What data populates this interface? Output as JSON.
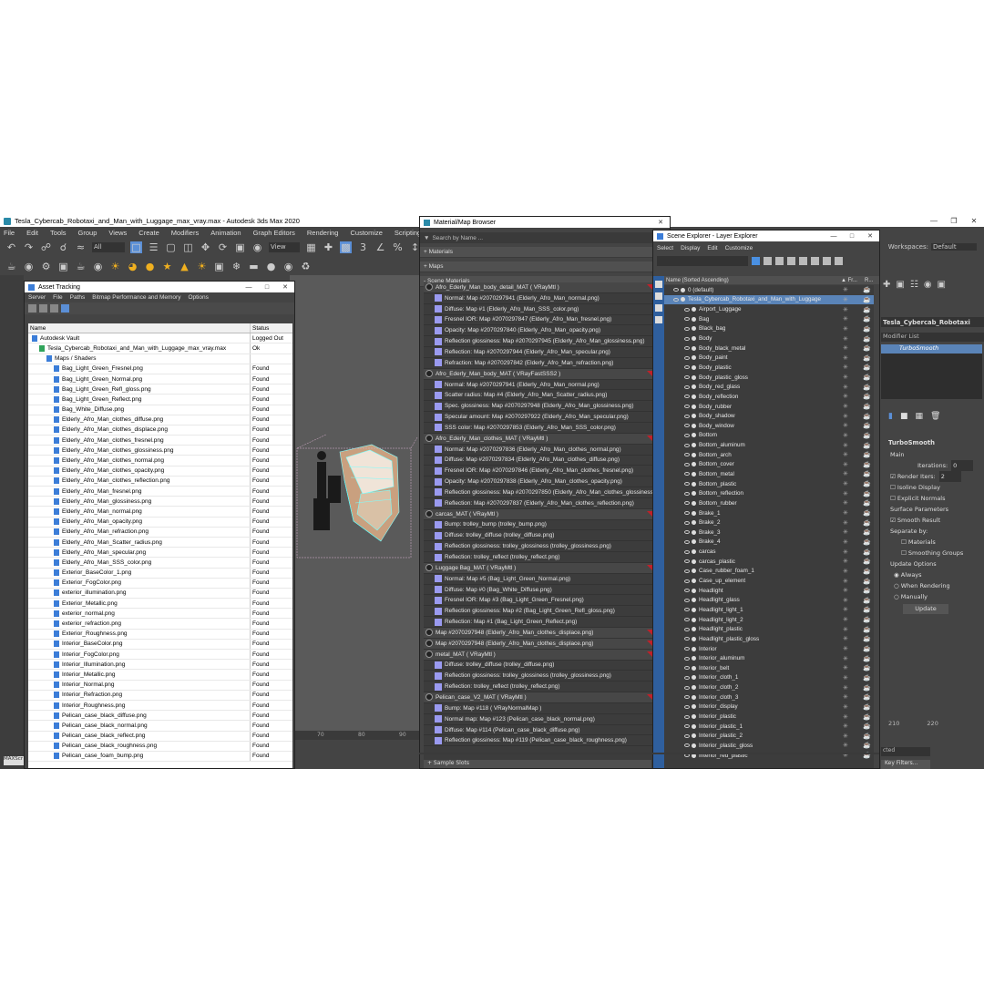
{
  "app": {
    "title": "Tesla_Cybercab_Robotaxi_and_Man_with_Luggage_max_vray.max - Autodesk 3ds Max 2020",
    "menu": [
      "File",
      "Edit",
      "Tools",
      "Group",
      "Views",
      "Create",
      "Modifiers",
      "Animation",
      "Graph Editors",
      "Rendering",
      "Customize",
      "Scripting"
    ],
    "workspace_label": "Workspaces:",
    "workspace_value": "Default",
    "view_dropdown": "View",
    "all_dropdown": "All",
    "ruler_ticks": [
      "70",
      "80",
      "90"
    ],
    "right_ruler": [
      "210",
      "220"
    ],
    "key_filters": "Key Filters...",
    "maxscript": "MAXScr"
  },
  "asset": {
    "title": "Asset Tracking",
    "menu": [
      "Server",
      "File",
      "Paths",
      "Bitmap Performance and Memory",
      "Options"
    ],
    "col_name": "Name",
    "col_status": "Status",
    "rows": [
      {
        "name": "Autodesk Vault",
        "status": "Logged Out",
        "level": 0
      },
      {
        "name": "Tesla_Cybercab_Robotaxi_and_Man_with_Luggage_max_vray.max",
        "status": "Ok",
        "level": 1
      },
      {
        "name": "Maps / Shaders",
        "status": "",
        "level": 2
      },
      {
        "name": "Bag_Light_Green_Fresnel.png",
        "status": "Found",
        "level": 3
      },
      {
        "name": "Bag_Light_Green_Normal.png",
        "status": "Found",
        "level": 3
      },
      {
        "name": "Bag_Light_Green_Refl_gloss.png",
        "status": "Found",
        "level": 3
      },
      {
        "name": "Bag_Light_Green_Reflect.png",
        "status": "Found",
        "level": 3
      },
      {
        "name": "Bag_White_Diffuse.png",
        "status": "Found",
        "level": 3
      },
      {
        "name": "Elderly_Afro_Man_clothes_diffuse.png",
        "status": "Found",
        "level": 3
      },
      {
        "name": "Elderly_Afro_Man_clothes_displace.png",
        "status": "Found",
        "level": 3
      },
      {
        "name": "Elderly_Afro_Man_clothes_fresnel.png",
        "status": "Found",
        "level": 3
      },
      {
        "name": "Elderly_Afro_Man_clothes_glossiness.png",
        "status": "Found",
        "level": 3
      },
      {
        "name": "Elderly_Afro_Man_clothes_normal.png",
        "status": "Found",
        "level": 3
      },
      {
        "name": "Elderly_Afro_Man_clothes_opacity.png",
        "status": "Found",
        "level": 3
      },
      {
        "name": "Elderly_Afro_Man_clothes_reflection.png",
        "status": "Found",
        "level": 3
      },
      {
        "name": "Elderly_Afro_Man_fresnel.png",
        "status": "Found",
        "level": 3
      },
      {
        "name": "Elderly_Afro_Man_glossiness.png",
        "status": "Found",
        "level": 3
      },
      {
        "name": "Elderly_Afro_Man_normal.png",
        "status": "Found",
        "level": 3
      },
      {
        "name": "Elderly_Afro_Man_opacity.png",
        "status": "Found",
        "level": 3
      },
      {
        "name": "Elderly_Afro_Man_refraction.png",
        "status": "Found",
        "level": 3
      },
      {
        "name": "Elderly_Afro_Man_Scatter_radius.png",
        "status": "Found",
        "level": 3
      },
      {
        "name": "Elderly_Afro_Man_specular.png",
        "status": "Found",
        "level": 3
      },
      {
        "name": "Elderly_Afro_Man_SSS_color.png",
        "status": "Found",
        "level": 3
      },
      {
        "name": "Exterior_BaseColor_1.png",
        "status": "Found",
        "level": 3
      },
      {
        "name": "Exterior_FogColor.png",
        "status": "Found",
        "level": 3
      },
      {
        "name": "exterior_illumination.png",
        "status": "Found",
        "level": 3
      },
      {
        "name": "Exterior_Metallic.png",
        "status": "Found",
        "level": 3
      },
      {
        "name": "exterior_normal.png",
        "status": "Found",
        "level": 3
      },
      {
        "name": "exterior_refraction.png",
        "status": "Found",
        "level": 3
      },
      {
        "name": "Exterior_Roughness.png",
        "status": "Found",
        "level": 3
      },
      {
        "name": "Interior_BaseColor.png",
        "status": "Found",
        "level": 3
      },
      {
        "name": "Interior_FogColor.png",
        "status": "Found",
        "level": 3
      },
      {
        "name": "Interior_Illumination.png",
        "status": "Found",
        "level": 3
      },
      {
        "name": "Interior_Metallic.png",
        "status": "Found",
        "level": 3
      },
      {
        "name": "Interior_Normal.png",
        "status": "Found",
        "level": 3
      },
      {
        "name": "Interior_Refraction.png",
        "status": "Found",
        "level": 3
      },
      {
        "name": "Interior_Roughness.png",
        "status": "Found",
        "level": 3
      },
      {
        "name": "Pelican_case_black_diffuse.png",
        "status": "Found",
        "level": 3
      },
      {
        "name": "Pelican_case_black_normal.png",
        "status": "Found",
        "level": 3
      },
      {
        "name": "Pelican_case_black_reflect.png",
        "status": "Found",
        "level": 3
      },
      {
        "name": "Pelican_case_black_roughness.png",
        "status": "Found",
        "level": 3
      },
      {
        "name": "Pelican_case_foam_bump.png",
        "status": "Found",
        "level": 3
      }
    ]
  },
  "mat": {
    "title": "Material/Map Browser",
    "search_placeholder": "Search by Name ...",
    "sections": [
      "+ Materials",
      "+ Maps",
      "- Scene Materials"
    ],
    "rows": [
      {
        "t": "Afro_Ederly_Man_body_detail_MAT ( VRayMtl )",
        "mat": true,
        "red": true
      },
      {
        "t": "Normal: Map #2070297941 (Elderly_Afro_Man_normal.png)"
      },
      {
        "t": "Diffuse: Map #1 (Elderly_Afro_Man_SSS_color.png)"
      },
      {
        "t": "Fresnel IOR: Map #2070297847 (Elderly_Afro_Man_fresnel.png)"
      },
      {
        "t": "Opacity: Map #2070297840 (Elderly_Afro_Man_opacity.png)"
      },
      {
        "t": "Reflection glossiness: Map #2070297945 (Elderly_Afro_Man_glossiness.png)"
      },
      {
        "t": "Reflection: Map #2070297944 (Elderly_Afro_Man_specular.png)"
      },
      {
        "t": "Refraction: Map #2070297842 (Elderly_Afro_Man_refraction.png)"
      },
      {
        "t": "Afro_Ederly_Man_body_MAT ( VRayFastSSS2 )",
        "mat": true,
        "red": true
      },
      {
        "t": "Normal: Map #2070297941 (Elderly_Afro_Man_normal.png)"
      },
      {
        "t": "Scatter radius: Map #4 (Elderly_Afro_Man_Scatter_radius.png)"
      },
      {
        "t": "Spec. glossiness: Map #2070297948 (Elderly_Afro_Man_glossiness.png)"
      },
      {
        "t": "Specular amount: Map #2070297922 (Elderly_Afro_Man_specular.png)"
      },
      {
        "t": "SSS color: Map #2070297853 (Elderly_Afro_Man_SSS_color.png)"
      },
      {
        "t": "Afro_Ederly_Man_clothes_MAT ( VRayMtl )",
        "mat": true,
        "red": true
      },
      {
        "t": "Normal: Map #2070297836 (Elderly_Afro_Man_clothes_normal.png)"
      },
      {
        "t": "Diffuse: Map #2070297834 (Elderly_Afro_Man_clothes_diffuse.png)"
      },
      {
        "t": "Fresnel IOR: Map #2070297846 (Elderly_Afro_Man_clothes_fresnel.png)"
      },
      {
        "t": "Opacity: Map #2070297838 (Elderly_Afro_Man_clothes_opacity.png)"
      },
      {
        "t": "Reflection glossiness: Map #2070297850 (Elderly_Afro_Man_clothes_glossiness.png)"
      },
      {
        "t": "Reflection: Map #2070297837 (Elderly_Afro_Man_clothes_reflection.png)"
      },
      {
        "t": "carcas_MAT ( VRayMtl )",
        "mat": true,
        "red": true
      },
      {
        "t": "Bump: trolley_bump (trolley_bump.png)"
      },
      {
        "t": "Diffuse: trolley_diffuse (trolley_diffuse.png)"
      },
      {
        "t": "Reflection glossiness: trolley_glossiness (trolley_glossiness.png)"
      },
      {
        "t": "Reflection: trolley_reflect (trolley_reflect.png)"
      },
      {
        "t": "Luggage Bag_MAT ( VRayMtl )",
        "mat": true,
        "red": true
      },
      {
        "t": "Normal: Map #5 (Bag_Light_Green_Normal.png)"
      },
      {
        "t": "Diffuse: Map #0 (Bag_White_Diffuse.png)"
      },
      {
        "t": "Fresnel IOR: Map #3 (Bag_Light_Green_Fresnel.png)"
      },
      {
        "t": "Reflection glossiness: Map #2 (Bag_Light_Green_Refl_gloss.png)"
      },
      {
        "t": "Reflection: Map #1 (Bag_Light_Green_Reflect.png)"
      },
      {
        "t": "Map #2070297948 (Elderly_Afro_Man_clothes_displace.png)",
        "mat": true,
        "red": true
      },
      {
        "t": "Map #2070297948 (Elderly_Afro_Man_clothes_displace.png)",
        "mat": true,
        "red": true
      },
      {
        "t": "metal_MAT ( VRayMtl )",
        "mat": true,
        "red": true
      },
      {
        "t": "Diffuse: trolley_diffuse (trolley_diffuse.png)"
      },
      {
        "t": "Reflection glossiness: trolley_glossiness (trolley_glossiness.png)"
      },
      {
        "t": "Reflection: trolley_reflect (trolley_reflect.png)"
      },
      {
        "t": "Pelican_case_V2_MAT ( VRayMtl )",
        "mat": true,
        "red": true
      },
      {
        "t": "Bump: Map #118 ( VRayNormalMap )"
      },
      {
        "t": "Normal map: Map #123 (Pelican_case_black_normal.png)"
      },
      {
        "t": "Diffuse: Map #114 (Pelican_case_black_diffuse.png)"
      },
      {
        "t": "Reflection glossiness: Map #119 (Pelican_case_black_roughness.png)"
      }
    ],
    "footer": "+ Sample Slots"
  },
  "scene": {
    "title": "Scene Explorer - Layer Explorer",
    "menu": [
      "Select",
      "Display",
      "Edit",
      "Customize"
    ],
    "col_name": "Name (Sorted Ascending)",
    "col_fr": "▲ Fr...",
    "col_r": "R...",
    "rows": [
      {
        "t": "0 (default)",
        "lvl": 0
      },
      {
        "t": "Tesla_Cybercab_Robotaxi_and_Man_with_Luggage",
        "lvl": 0,
        "sel": true
      },
      {
        "t": "Airport_Luggage",
        "lvl": 1
      },
      {
        "t": "Bag",
        "lvl": 1
      },
      {
        "t": "Black_bag",
        "lvl": 1
      },
      {
        "t": "Body",
        "lvl": 1
      },
      {
        "t": "Body_black_metal",
        "lvl": 1
      },
      {
        "t": "Body_paint",
        "lvl": 1
      },
      {
        "t": "Body_plastic",
        "lvl": 1
      },
      {
        "t": "Body_plastic_gloss",
        "lvl": 1
      },
      {
        "t": "Body_red_glass",
        "lvl": 1
      },
      {
        "t": "Body_reflection",
        "lvl": 1
      },
      {
        "t": "Body_rubber",
        "lvl": 1
      },
      {
        "t": "Body_shadow",
        "lvl": 1
      },
      {
        "t": "Body_window",
        "lvl": 1
      },
      {
        "t": "Bottom",
        "lvl": 1
      },
      {
        "t": "Bottom_aluminum",
        "lvl": 1
      },
      {
        "t": "Bottom_arch",
        "lvl": 1
      },
      {
        "t": "Bottom_cover",
        "lvl": 1
      },
      {
        "t": "Bottom_metal",
        "lvl": 1
      },
      {
        "t": "Bottom_plastic",
        "lvl": 1
      },
      {
        "t": "Bottom_reflection",
        "lvl": 1
      },
      {
        "t": "Bottom_rubber",
        "lvl": 1
      },
      {
        "t": "Brake_1",
        "lvl": 1
      },
      {
        "t": "Brake_2",
        "lvl": 1
      },
      {
        "t": "Brake_3",
        "lvl": 1
      },
      {
        "t": "Brake_4",
        "lvl": 1
      },
      {
        "t": "carcas",
        "lvl": 1
      },
      {
        "t": "carcas_plastic",
        "lvl": 1
      },
      {
        "t": "Case_rubber_foam_1",
        "lvl": 1
      },
      {
        "t": "Case_up_element",
        "lvl": 1
      },
      {
        "t": "Headlight",
        "lvl": 1
      },
      {
        "t": "Headlight_glass",
        "lvl": 1
      },
      {
        "t": "Headlight_light_1",
        "lvl": 1
      },
      {
        "t": "Headlight_light_2",
        "lvl": 1
      },
      {
        "t": "Headlight_plastic",
        "lvl": 1
      },
      {
        "t": "Headlight_plastic_gloss",
        "lvl": 1
      },
      {
        "t": "Interior",
        "lvl": 1
      },
      {
        "t": "Interior_aluminum",
        "lvl": 1
      },
      {
        "t": "Interior_belt",
        "lvl": 1
      },
      {
        "t": "Interior_cloth_1",
        "lvl": 1
      },
      {
        "t": "Interior_cloth_2",
        "lvl": 1
      },
      {
        "t": "Interior_cloth_3",
        "lvl": 1
      },
      {
        "t": "Interior_display",
        "lvl": 1
      },
      {
        "t": "Interior_plastic",
        "lvl": 1
      },
      {
        "t": "Interior_plastic_1",
        "lvl": 1
      },
      {
        "t": "Interior_plastic_2",
        "lvl": 1
      },
      {
        "t": "Interior_plastic_gloss",
        "lvl": 1
      },
      {
        "t": "Interior_red_plastic",
        "lvl": 1
      }
    ]
  },
  "cmd": {
    "object_name": "Tesla_Cybercab_Robotaxi",
    "modifier_list": "Modifier List",
    "stack_item": "TurboSmooth",
    "rollout": "TurboSmooth",
    "main": "Main",
    "iterations_label": "Iterations:",
    "iterations_value": "0",
    "render_iters_label": "Render Iters:",
    "render_iters_value": "2",
    "isoline": "Isoline Display",
    "explicit": "Explicit Normals",
    "surface": "Surface Parameters",
    "smooth_result": "Smooth Result",
    "separate_by": "Separate by:",
    "materials": "Materials",
    "smoothing_groups": "Smoothing Groups",
    "update_options": "Update Options",
    "always": "Always",
    "when_rendering": "When Rendering",
    "manually": "Manually",
    "update": "Update",
    "selected": "cted"
  }
}
